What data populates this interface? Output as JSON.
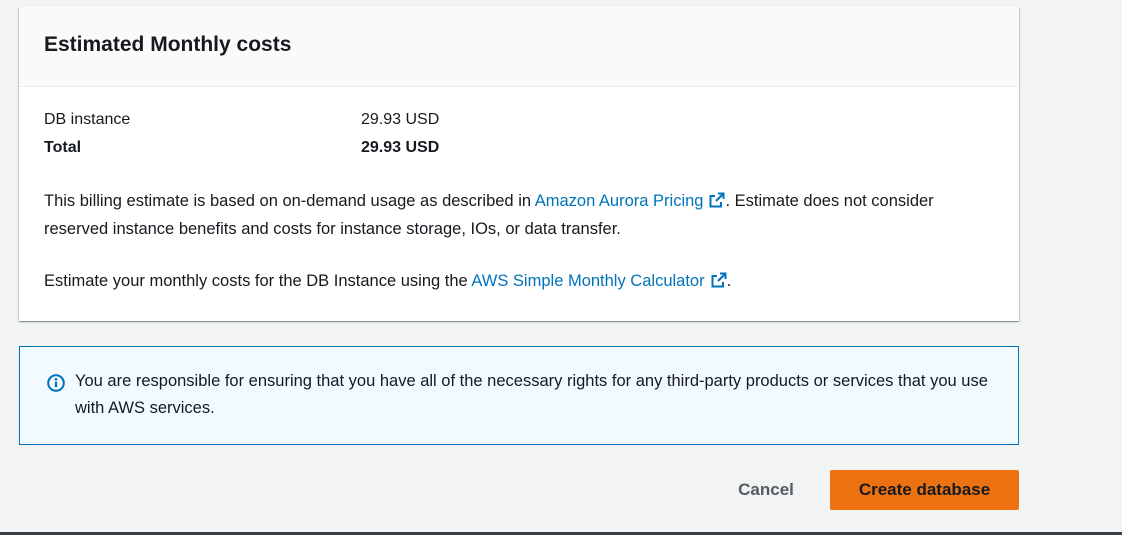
{
  "costs_panel": {
    "title": "Estimated Monthly costs",
    "rows": [
      {
        "label": "DB instance",
        "value": "29.93 USD"
      },
      {
        "label": "Total",
        "value": "29.93 USD"
      }
    ],
    "billing_text_before": "This billing estimate is based on on-demand usage as described in ",
    "billing_link": "Amazon Aurora Pricing",
    "billing_text_after": ". Estimate does not consider reserved instance benefits and costs for instance storage, IOs, or data transfer.",
    "calc_text_before": "Estimate your monthly costs for the DB Instance using the ",
    "calc_link": "AWS Simple Monthly Calculator",
    "calc_text_after": "."
  },
  "info_alert": {
    "icon": "info-icon",
    "text": "You are responsible for ensuring that you have all of the necessary rights for any third-party products or services that you use with AWS services."
  },
  "actions": {
    "cancel_label": "Cancel",
    "create_label": "Create database"
  },
  "colors": {
    "primary_button": "#ec7211",
    "link": "#0073bb",
    "info_border": "#0073bb",
    "info_background": "#f1faff"
  }
}
